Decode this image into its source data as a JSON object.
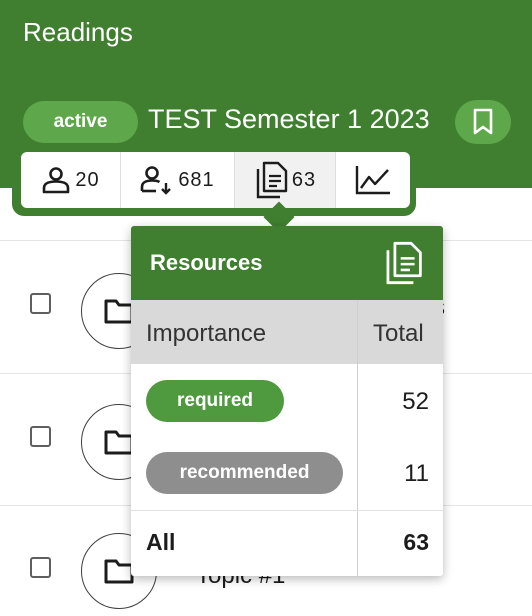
{
  "header": {
    "title": "Readings",
    "status": "active",
    "semester": "TEST Semester 1 2023",
    "bookmark_icon": "bookmark-icon"
  },
  "stats": {
    "students": {
      "icon": "person-icon",
      "count": "20"
    },
    "downloads": {
      "icon": "person-download-icon",
      "count": "681"
    },
    "resources": {
      "icon": "documents-icon",
      "count": "63"
    },
    "analytics": {
      "icon": "line-chart-icon"
    }
  },
  "list": {
    "rows": [
      {
        "title": "s"
      },
      {
        "title": ""
      },
      {
        "title": "Topic #1"
      }
    ]
  },
  "popover": {
    "title": "Resources",
    "icon": "documents-icon",
    "col_importance": "Importance",
    "col_total": "Total",
    "rows": [
      {
        "label": "required",
        "total": "52",
        "color": "#4f9a3f"
      },
      {
        "label": "recommended",
        "total": "11",
        "color": "#8e8e8e"
      }
    ],
    "all_label": "All",
    "all_total": "63"
  },
  "colors": {
    "brand_green": "#3f7f2f",
    "pill_green": "#5ea84b"
  }
}
